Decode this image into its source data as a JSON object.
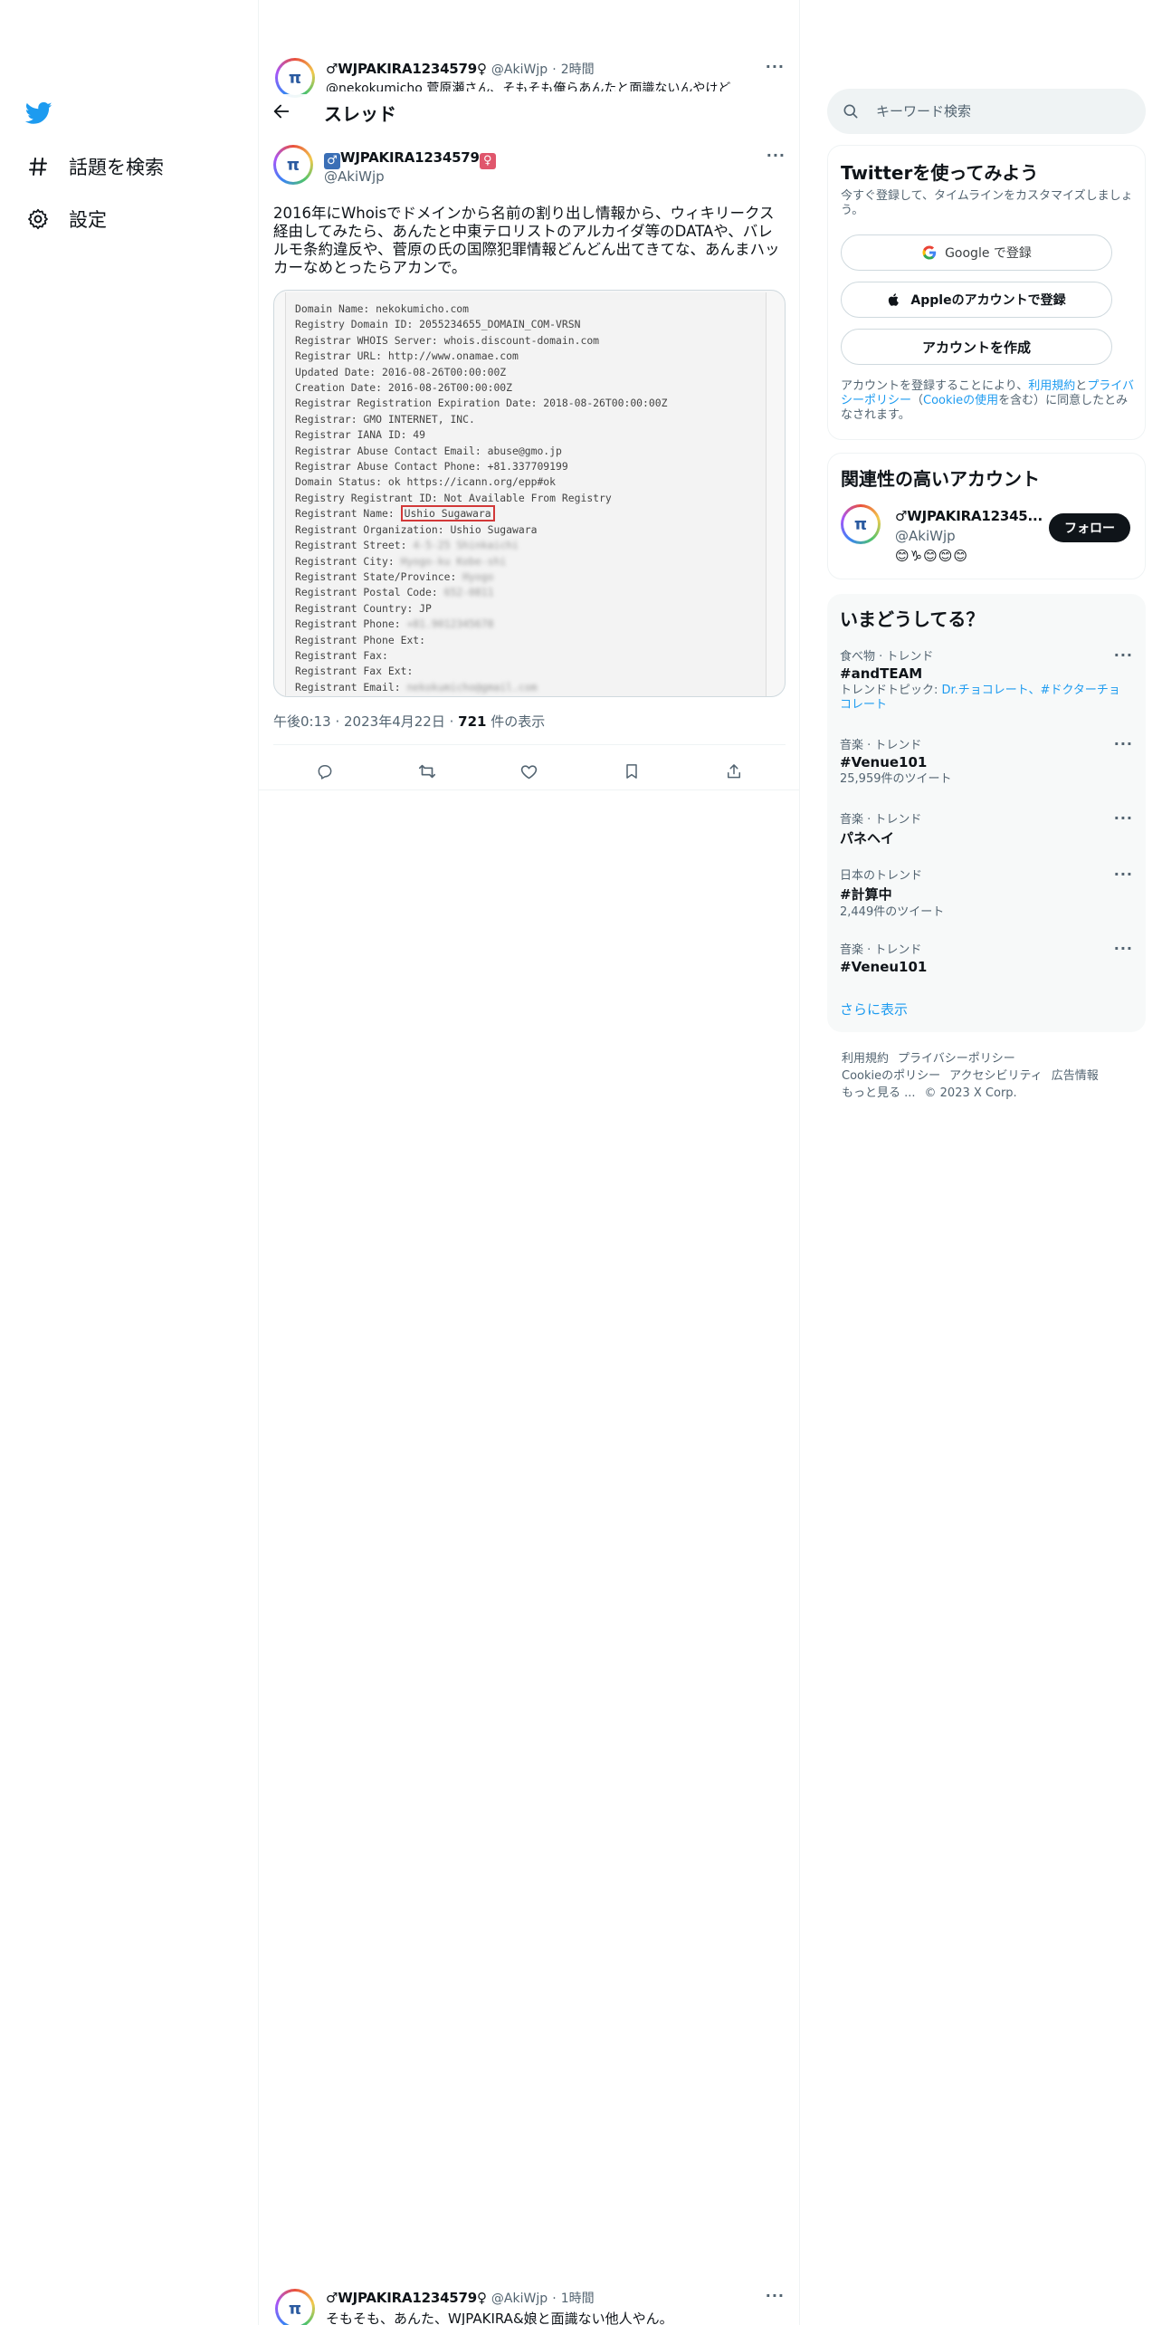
{
  "nav": {
    "explore_label": "話題を検索",
    "settings_label": "設定"
  },
  "top_tweet": {
    "name": "♂WJPAKIRA1234579♀",
    "handle": "@AkiWjp",
    "time": "2時間",
    "text": "@nekokumicho 菅原瀬さん、そもそも俺らあんたと面識ないんやけど"
  },
  "thread": {
    "title": "スレッド"
  },
  "main_tweet": {
    "male_mark": "♂",
    "name_core": "WJPAKIRA1234579",
    "female_mark": "♀",
    "handle": "@AkiWjp",
    "text": "2016年にWhoisでドメインから名前の割り出し情報から、ウィキリークス経由してみたら、あんたと中東テロリストのアルカイダ等のDATAや、バレルモ条約違反や、菅原の氏の国際犯罪情報どんどん出てきてな、あんまハッカーなめとったらアカンで。",
    "time": "午後0:13",
    "date": "2023年4月22日",
    "views_count": "721",
    "views_label": "件の表示"
  },
  "whois": {
    "lines": [
      [
        "Domain Name: nekokumicho.com",
        ""
      ],
      [
        "Registry Domain ID: 2055234655_DOMAIN_COM-VRSN",
        ""
      ],
      [
        "Registrar WHOIS Server: whois.discount-domain.com",
        ""
      ],
      [
        "Registrar URL: http://www.onamae.com",
        ""
      ],
      [
        "Updated Date: 2016-08-26T00:00:00Z",
        ""
      ],
      [
        "Creation Date: 2016-08-26T00:00:00Z",
        ""
      ],
      [
        "Registrar Registration Expiration Date: 2018-08-26T00:00:00Z",
        ""
      ],
      [
        "Registrar: GMO INTERNET, INC.",
        ""
      ],
      [
        "Registrar IANA ID: 49",
        ""
      ],
      [
        "Registrar Abuse Contact Email: abuse@gmo.jp",
        ""
      ],
      [
        "Registrar Abuse Contact Phone: +81.337709199",
        ""
      ],
      [
        "Domain Status: ok https://icann.org/epp#ok",
        ""
      ],
      [
        "Registry Registrant ID: Not Available From Registry",
        ""
      ],
      [
        "Registrant Name: ",
        "Ushio Sugawara"
      ],
      [
        "Registrant Organization: Ushio Sugawara",
        ""
      ],
      [
        "Registrant Street: ",
        "4-5-25 Shinkaichi"
      ],
      [
        "Registrant City: ",
        "Hyogo-ku Kobe-shi"
      ],
      [
        "Registrant State/Province: ",
        "Hyogo"
      ],
      [
        "Registrant Postal Code: ",
        "652-0811"
      ],
      [
        "Registrant Country: JP",
        ""
      ],
      [
        "Registrant Phone: ",
        "+81.9012345678"
      ],
      [
        "Registrant Phone Ext:",
        ""
      ],
      [
        "Registrant Fax:",
        ""
      ],
      [
        "Registrant Fax Ext:",
        ""
      ],
      [
        "Registrant Email: ",
        "nekokumicho@gmail.com"
      ]
    ]
  },
  "bottom_tweet": {
    "name": "♂WJPAKIRA1234579♀",
    "handle": "@AkiWjp",
    "time": "1時間",
    "text": "そもそも、あんた、WJPAKIRA&娘と面識ない他人やん。"
  },
  "search": {
    "placeholder": "キーワード検索"
  },
  "signup": {
    "title": "Twitterを使ってみよう",
    "subtitle": "今すぐ登録して、タイムラインをカスタマイズしましょう。",
    "google": "Google で登録",
    "apple": "Appleのアカウントで登録",
    "create": "アカウントを作成",
    "legal_1": "アカウントを登録することにより、",
    "legal_terms": "利用規約",
    "legal_2": "と",
    "legal_privacy": "プライバシーポリシー",
    "legal_3": "（",
    "legal_cookie": "Cookieの使用",
    "legal_4": "を含む）に同意したとみなされます。"
  },
  "related": {
    "title": "関連性の高いアカウント",
    "name": "♂WJPAKIRA12345...",
    "handle": "@AkiWjp",
    "emojis": "😊♑😊😊😊",
    "follow": "フォロー"
  },
  "trends": {
    "title": "いまどうしてる？",
    "items": [
      {
        "category": "食べ物 · トレンド",
        "title": "#andTEAM",
        "extra_prefix": "トレンドトピック: ",
        "extra_links": "Dr.チョコレート、#ドクターチョコレート"
      },
      {
        "category": "音楽 · トレンド",
        "title": "#Venue101",
        "extra": "25,959件のツイート"
      },
      {
        "category": "音楽 · トレンド",
        "title": "パネヘイ"
      },
      {
        "category": "日本のトレンド",
        "title": "#計算中",
        "extra": "2,449件のツイート"
      },
      {
        "category": "音楽 · トレンド",
        "title": "#Veneu101"
      }
    ],
    "show_more": "さらに表示"
  },
  "footer": {
    "terms": "利用規約",
    "privacy": "プライバシーポリシー",
    "cookie": "Cookieのポリシー",
    "accessibility": "アクセシビリティ",
    "ads": "広告情報",
    "more": "もっと見る ...",
    "copyright": "© 2023 X Corp."
  },
  "colors": {
    "accent": "#1d9bf0",
    "text": "#0f1419",
    "muted": "#536471"
  }
}
